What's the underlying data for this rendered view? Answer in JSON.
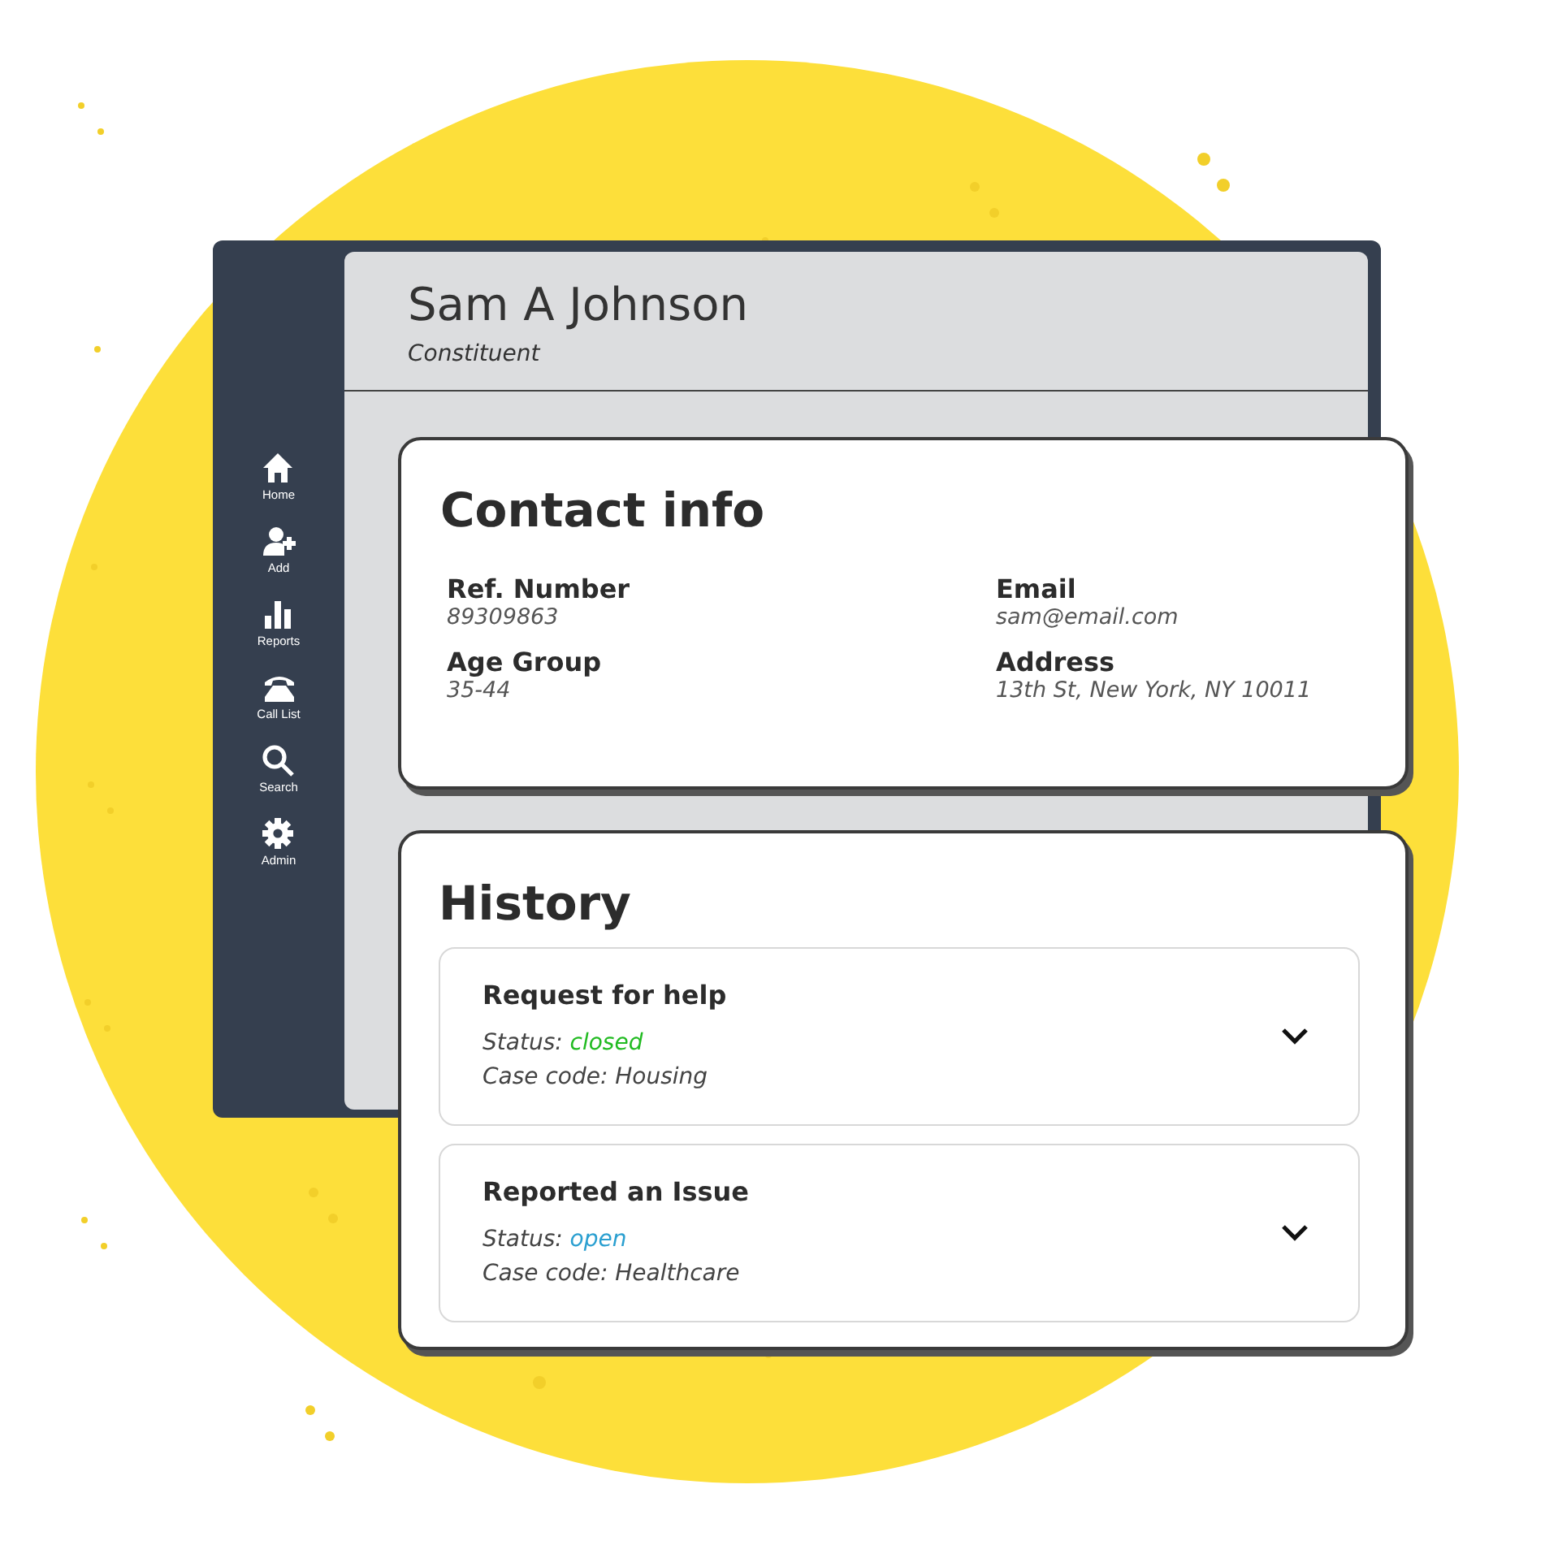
{
  "profile": {
    "name": "Sam A Johnson",
    "role": "Constituent"
  },
  "sidebar": {
    "items": [
      {
        "label": "Home"
      },
      {
        "label": "Add"
      },
      {
        "label": "Reports"
      },
      {
        "label": "Call List"
      },
      {
        "label": "Search"
      },
      {
        "label": "Admin"
      }
    ]
  },
  "contact_info": {
    "title": "Contact info",
    "fields": [
      {
        "label": "Ref. Number",
        "value": "89309863"
      },
      {
        "label": "Email",
        "value": "sam@email.com"
      },
      {
        "label": "Age Group",
        "value": "35-44"
      },
      {
        "label": "Address",
        "value": "13th St, New York, NY 10011"
      }
    ]
  },
  "history": {
    "title": "History",
    "entries": [
      {
        "title": "Request for help",
        "status_label": "Status:",
        "status": "closed",
        "color": "#22bb22",
        "case_code": "Case code: Housing",
        "expanded": false
      },
      {
        "title": "Reported an Issue",
        "status_label": "Status:",
        "status": "open",
        "color": "#2a9fd0",
        "case_code": "Case code: Healthcare",
        "expanded": false
      }
    ]
  }
}
